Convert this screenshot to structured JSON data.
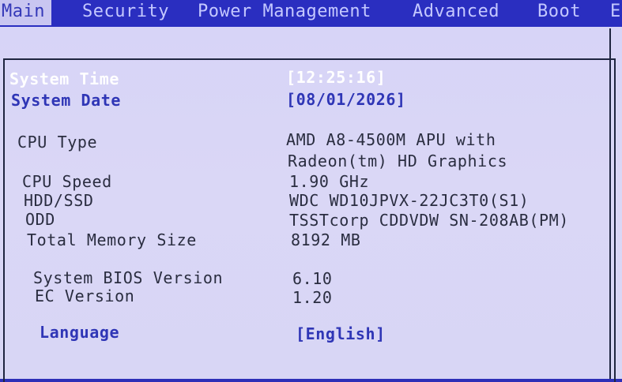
{
  "menu": {
    "tabs": [
      {
        "label": "Main"
      },
      {
        "label": "Security"
      },
      {
        "label": "Power Management"
      },
      {
        "label": "Advanced"
      },
      {
        "label": "Boot"
      },
      {
        "label": "E"
      }
    ]
  },
  "main": {
    "system_time": {
      "label": "System Time",
      "value": "[12:25:16]"
    },
    "system_date": {
      "label": "System Date",
      "value": "[08/01/2026]"
    },
    "cpu_type": {
      "label": "CPU Type",
      "value_line1": "AMD A8-4500M APU with",
      "value_line2": "Radeon(tm) HD Graphics"
    },
    "cpu_speed": {
      "label": "CPU Speed",
      "value": "1.90 GHz"
    },
    "hdd_ssd": {
      "label": "HDD/SSD",
      "value": "WDC WD10JPVX-22JC3T0(S1)"
    },
    "odd": {
      "label": "ODD",
      "value": "TSSTcorp CDDVDW SN-208AB(PM)"
    },
    "total_memory": {
      "label": "Total Memory Size",
      "value": "8192 MB"
    },
    "bios_version": {
      "label": "System BIOS Version",
      "value": "6.10"
    },
    "ec_version": {
      "label": "EC Version",
      "value": "1.20"
    },
    "language": {
      "label": "Language",
      "value": "[English]"
    }
  },
  "colors": {
    "menu_bar": "#2a2ec0",
    "active_tab_bg": "#c9c6f1",
    "panel_bg": "#d7d4f7",
    "highlight_text": "#ffffff",
    "selectable_text": "#2f36b6",
    "static_text": "#2a2d40"
  }
}
